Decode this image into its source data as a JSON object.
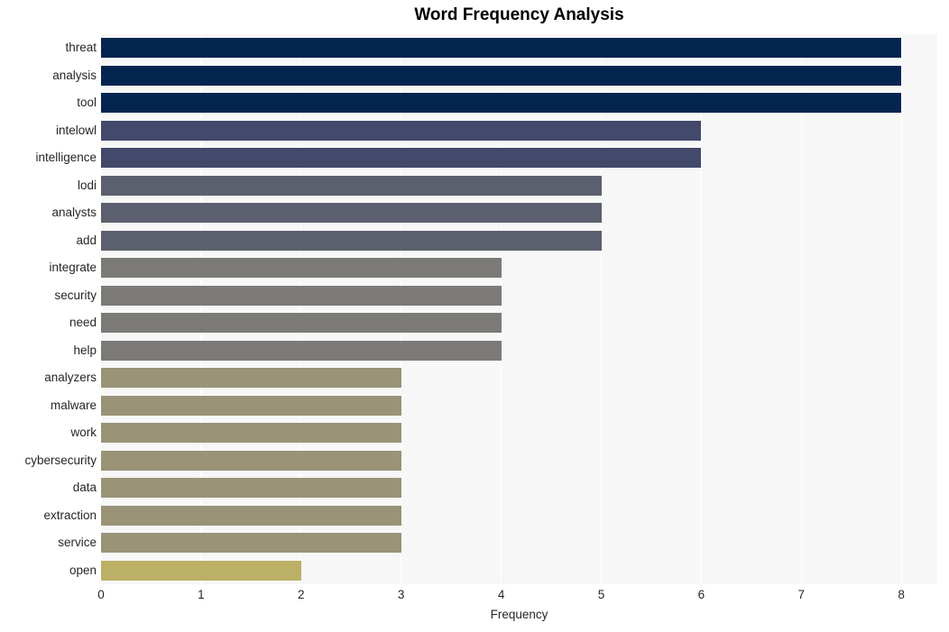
{
  "chart_data": {
    "type": "bar",
    "orientation": "horizontal",
    "title": "Word Frequency Analysis",
    "xlabel": "Frequency",
    "ylabel": "",
    "xlim": [
      0,
      8
    ],
    "xticks": [
      "0",
      "1",
      "2",
      "3",
      "4",
      "5",
      "6",
      "7",
      "8"
    ],
    "grid": true,
    "grid_axis": "x",
    "legend": "none",
    "categories": [
      "threat",
      "analysis",
      "tool",
      "intelowl",
      "intelligence",
      "lodi",
      "analysts",
      "add",
      "integrate",
      "security",
      "need",
      "help",
      "analyzers",
      "malware",
      "work",
      "cybersecurity",
      "data",
      "extraction",
      "service",
      "open"
    ],
    "values": [
      8,
      8,
      8,
      6,
      6,
      5,
      5,
      5,
      4,
      4,
      4,
      4,
      3,
      3,
      3,
      3,
      3,
      3,
      3,
      2
    ],
    "bar_colors": [
      "#04254f",
      "#04254f",
      "#04254f",
      "#42496b",
      "#42496b",
      "#5c606e",
      "#5c606e",
      "#5c606e",
      "#7b7a77",
      "#7b7a77",
      "#7b7a77",
      "#7b7a77",
      "#9a9377",
      "#9a9377",
      "#9a9377",
      "#9a9377",
      "#9a9377",
      "#9a9377",
      "#9a9377",
      "#bcb066"
    ],
    "panel_background": "#f7f7f7",
    "gridline_color": "#ffffff",
    "text_color": "#262626"
  }
}
